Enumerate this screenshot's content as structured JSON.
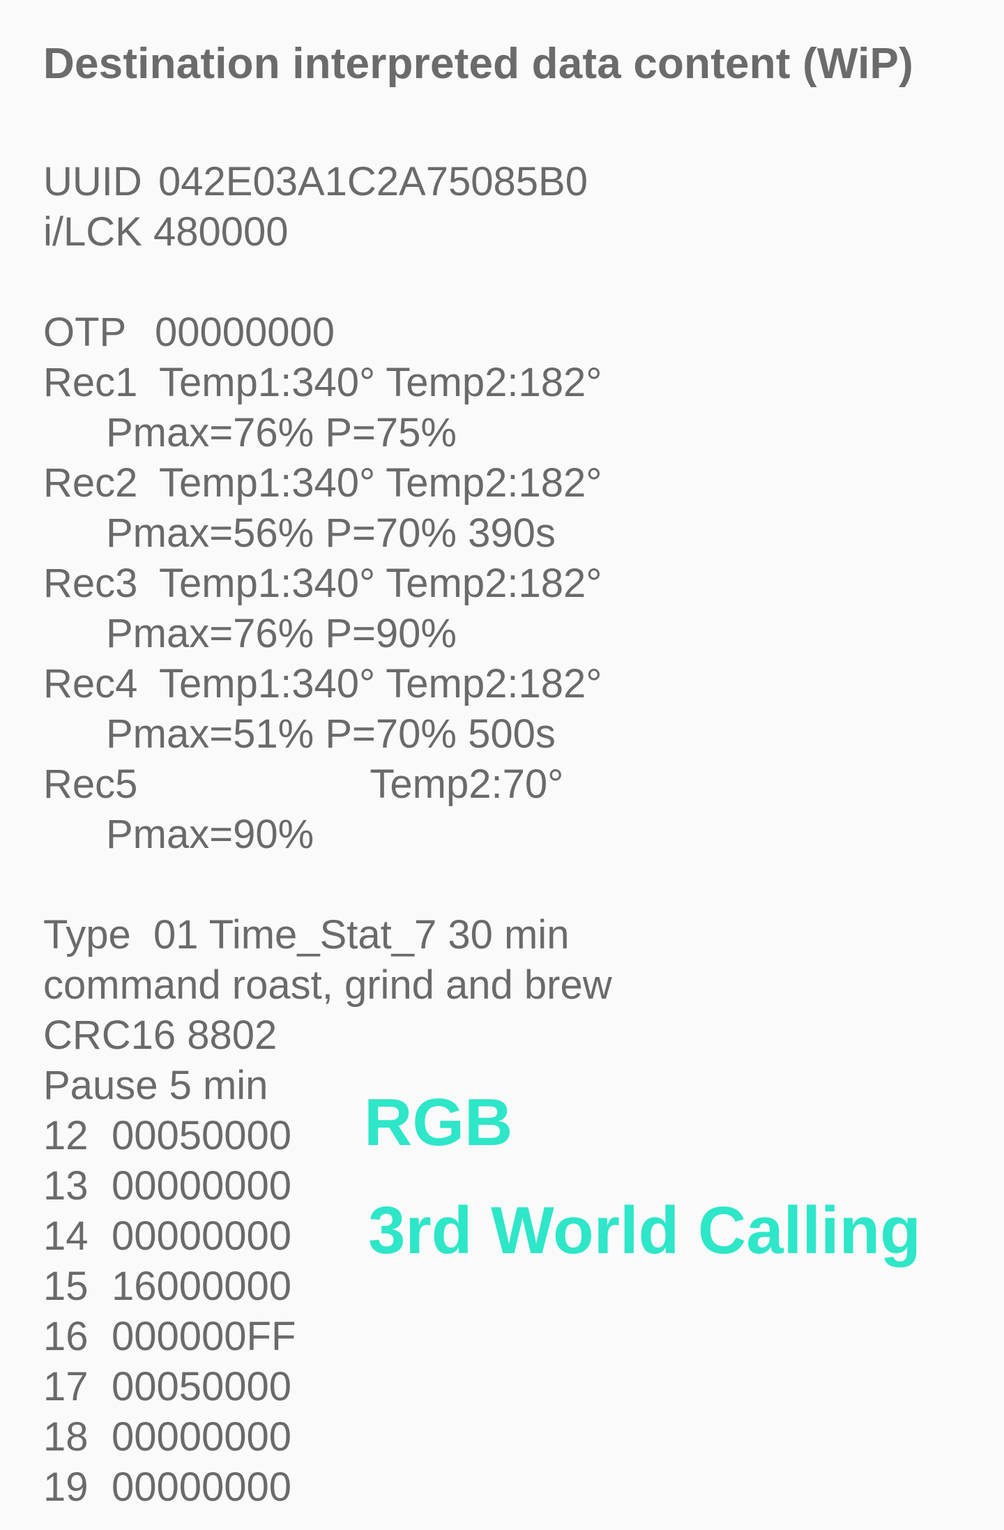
{
  "header": {
    "title": "Destination interpreted data content (WiP)"
  },
  "identity": {
    "uuid_key": "UUID",
    "uuid_value": "042E03A1C2A75085B0",
    "lck_key": "i/LCK",
    "lck_value": "480000"
  },
  "otp": {
    "key": "OTP",
    "value": "00000000"
  },
  "records": [
    {
      "key": "Rec1",
      "temp1": "Temp1:340°",
      "temp2": "Temp2:182°",
      "detail": "Pmax=76% P=75%"
    },
    {
      "key": "Rec2",
      "temp1": "Temp1:340°",
      "temp2": "Temp2:182°",
      "detail": "Pmax=56% P=70% 390s"
    },
    {
      "key": "Rec3",
      "temp1": "Temp1:340°",
      "temp2": "Temp2:182°",
      "detail": "Pmax=76% P=90%"
    },
    {
      "key": "Rec4",
      "temp1": "Temp1:340°",
      "temp2": "Temp2:182°",
      "detail": "Pmax=51% P=70% 500s"
    },
    {
      "key": "Rec5",
      "temp1": "",
      "temp2": "Temp2:70°",
      "detail": "Pmax=90%"
    }
  ],
  "meta": {
    "type_key": "Type",
    "type_value": "01 Time_Stat_7 30 min",
    "command": "command roast, grind and brew",
    "crc": "CRC16 8802",
    "pause": "Pause 5 min"
  },
  "registers": [
    {
      "index": "12",
      "value": "00050000"
    },
    {
      "index": "13",
      "value": "00000000"
    },
    {
      "index": "14",
      "value": "00000000"
    },
    {
      "index": "15",
      "value": "16000000"
    },
    {
      "index": "16",
      "value": "000000FF"
    },
    {
      "index": "17",
      "value": "00050000"
    },
    {
      "index": "18",
      "value": "00000000"
    },
    {
      "index": "19",
      "value": "00000000"
    }
  ],
  "overlay": {
    "line1": "RGB",
    "line2": "3rd World Calling",
    "color": "#2ee6c8"
  }
}
